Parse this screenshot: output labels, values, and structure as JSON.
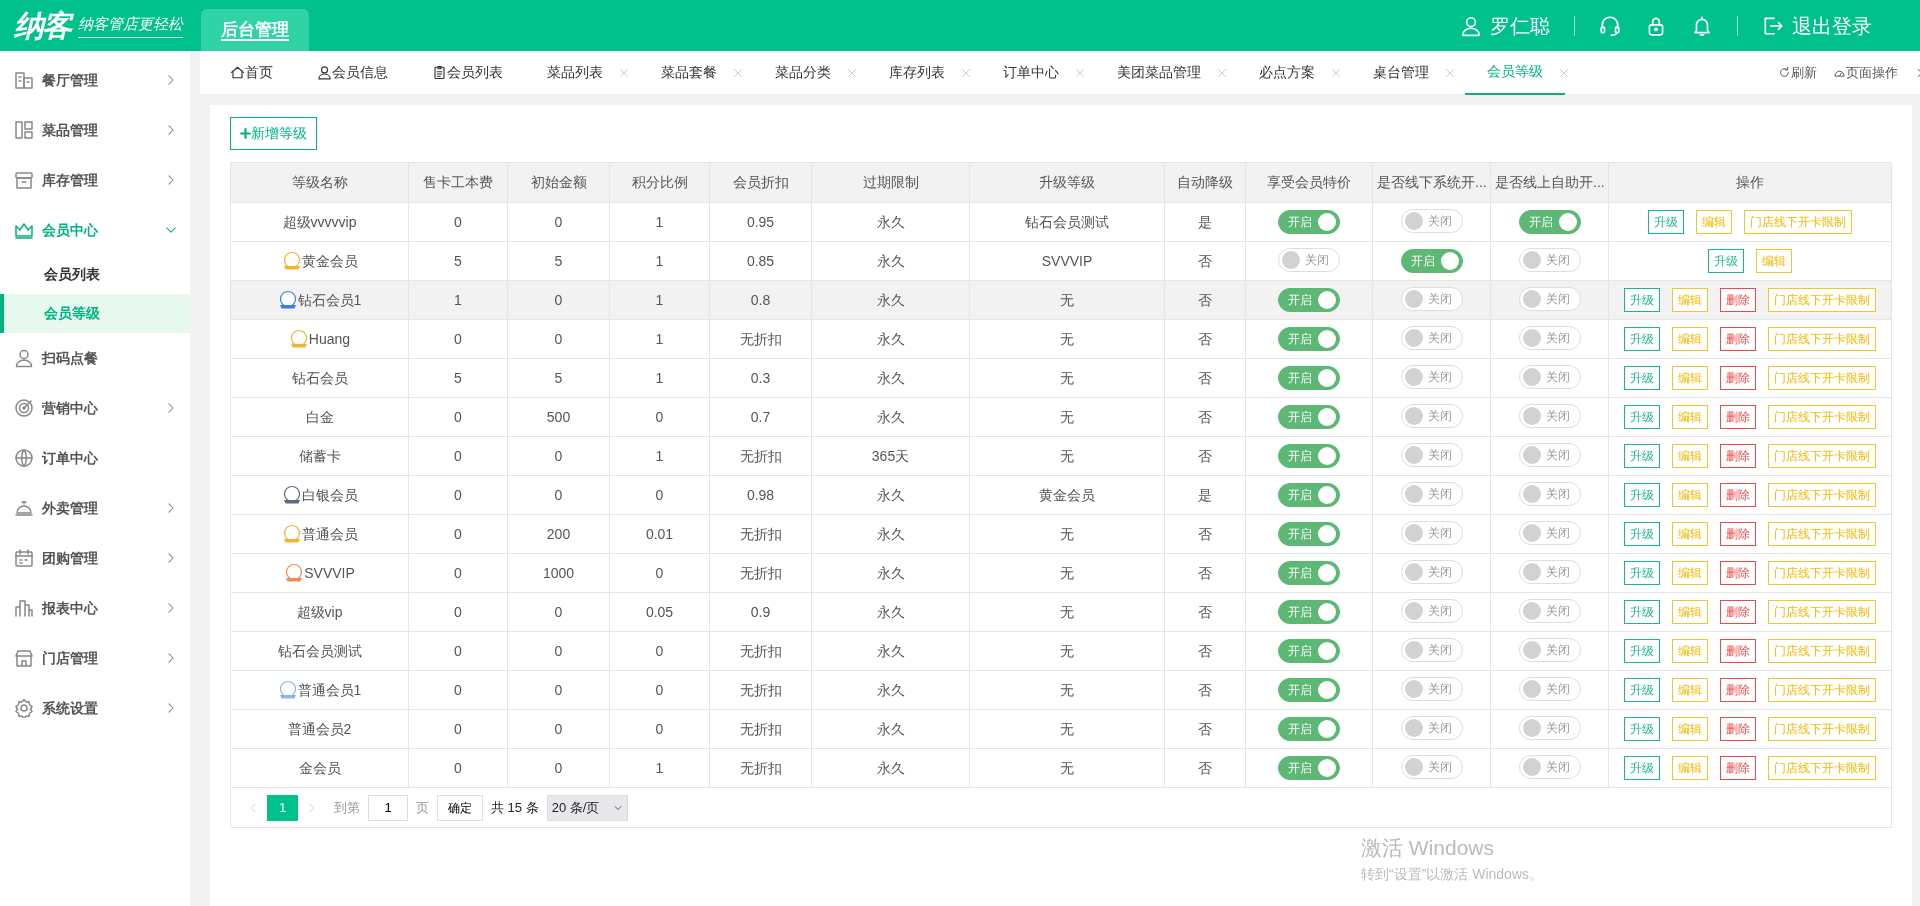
{
  "header": {
    "logo": "纳客",
    "slogan": "纳客管店更轻松",
    "nav": [
      {
        "label": "后台管理",
        "selected": true
      }
    ],
    "user": "罗仁聪",
    "logout": "退出登录"
  },
  "sidebar": {
    "items": [
      {
        "label": "餐厅管理",
        "expandable": true,
        "expanded": false
      },
      {
        "label": "菜品管理",
        "expandable": true,
        "expanded": false
      },
      {
        "label": "库存管理",
        "expandable": true,
        "expanded": false
      },
      {
        "label": "会员中心",
        "expandable": true,
        "expanded": true,
        "children": [
          {
            "label": "会员列表",
            "selected": false
          },
          {
            "label": "会员等级",
            "selected": true
          }
        ]
      },
      {
        "label": "扫码点餐",
        "expandable": false,
        "expanded": false
      },
      {
        "label": "营销中心",
        "expandable": true,
        "expanded": false
      },
      {
        "label": "订单中心",
        "expandable": false,
        "expanded": false
      },
      {
        "label": "外卖管理",
        "expandable": true,
        "expanded": false
      },
      {
        "label": "团购管理",
        "expandable": true,
        "expanded": false
      },
      {
        "label": "报表中心",
        "expandable": true,
        "expanded": false
      },
      {
        "label": "门店管理",
        "expandable": true,
        "expanded": false
      },
      {
        "label": "系统设置",
        "expandable": true,
        "expanded": false
      }
    ]
  },
  "tabs": [
    {
      "label": "首页",
      "closable": false,
      "selected": false
    },
    {
      "label": "会员信息",
      "closable": false,
      "selected": false
    },
    {
      "label": "会员列表",
      "closable": false,
      "selected": false
    },
    {
      "label": "菜品列表",
      "closable": true,
      "selected": false
    },
    {
      "label": "菜品套餐",
      "closable": true,
      "selected": false
    },
    {
      "label": "菜品分类",
      "closable": true,
      "selected": false
    },
    {
      "label": "库存列表",
      "closable": true,
      "selected": false
    },
    {
      "label": "订单中心",
      "closable": true,
      "selected": false
    },
    {
      "label": "美团菜品管理",
      "closable": true,
      "selected": false
    },
    {
      "label": "必点方案",
      "closable": true,
      "selected": false
    },
    {
      "label": "桌台管理",
      "closable": true,
      "selected": false
    },
    {
      "label": "会员等级",
      "closable": true,
      "selected": true
    }
  ],
  "tab_tools": [
    "刷新",
    "页面操作"
  ],
  "add_button": "新增等级",
  "table": {
    "columns": [
      "等级名称",
      "售卡工本费",
      "初始金额",
      "积分比例",
      "会员折扣",
      "过期限制",
      "升级等级",
      "自动降级",
      "享受会员特价",
      "是否线下系统开...",
      "是否线上自助开...",
      "操作"
    ],
    "rows": [
      {
        "hovered": false,
        "cells": [
          "超级vvvvvip",
          "0",
          "0",
          "1",
          "0.95",
          "永久",
          "钻石会员测试",
          "是"
        ],
        "toggles": [
          {
            "label": "开启",
            "on": true
          },
          {
            "label": "关闭",
            "on": false
          },
          {
            "label": "开启",
            "on": true
          }
        ],
        "actions": [
          {
            "kind": "upgrade",
            "label": "升级"
          },
          {
            "kind": "edit",
            "label": "编辑"
          },
          {
            "kind": "limit",
            "label": "门店线下开卡限制"
          }
        ]
      },
      {
        "color": "#f5b335",
        "hovered": false,
        "cells": [
          "黄金会员",
          "5",
          "5",
          "1",
          "0.85",
          "永久",
          "SVVVIP",
          "否"
        ],
        "toggles": [
          {
            "label": "关闭",
            "on": false
          },
          {
            "label": "开启",
            "on": true
          },
          {
            "label": "关闭",
            "on": false
          }
        ],
        "actions": [
          {
            "kind": "upgrade",
            "label": "升级"
          },
          {
            "kind": "edit",
            "label": "编辑"
          }
        ]
      },
      {
        "color": "#3d7fe0",
        "hovered": true,
        "cells": [
          "钻石会员1",
          "1",
          "0",
          "1",
          "0.8",
          "永久",
          "无",
          "否"
        ],
        "toggles": [
          {
            "label": "开启",
            "on": true
          },
          {
            "label": "关闭",
            "on": false
          },
          {
            "label": "关闭",
            "on": false
          }
        ],
        "actions": [
          {
            "kind": "upgrade",
            "label": "升级"
          },
          {
            "kind": "edit",
            "label": "编辑"
          },
          {
            "kind": "delete",
            "label": "删除"
          },
          {
            "kind": "limit",
            "label": "门店线下开卡限制"
          }
        ]
      },
      {
        "color": "#f5b335",
        "hovered": false,
        "cells": [
          "Huang",
          "0",
          "0",
          "1",
          "无折扣",
          "永久",
          "无",
          "否"
        ],
        "toggles": [
          {
            "label": "开启",
            "on": true
          },
          {
            "label": "关闭",
            "on": false
          },
          {
            "label": "关闭",
            "on": false
          }
        ],
        "actions": [
          {
            "kind": "upgrade",
            "label": "升级"
          },
          {
            "kind": "edit",
            "label": "编辑"
          },
          {
            "kind": "delete",
            "label": "删除"
          },
          {
            "kind": "limit",
            "label": "门店线下开卡限制"
          }
        ]
      },
      {
        "hovered": false,
        "cells": [
          "钻石会员",
          "5",
          "5",
          "1",
          "0.3",
          "永久",
          "无",
          "否"
        ],
        "toggles": [
          {
            "label": "开启",
            "on": true
          },
          {
            "label": "关闭",
            "on": false
          },
          {
            "label": "关闭",
            "on": false
          }
        ],
        "actions": [
          {
            "kind": "upgrade",
            "label": "升级"
          },
          {
            "kind": "edit",
            "label": "编辑"
          },
          {
            "kind": "delete",
            "label": "删除"
          },
          {
            "kind": "limit",
            "label": "门店线下开卡限制"
          }
        ]
      },
      {
        "hovered": false,
        "cells": [
          "白金",
          "0",
          "500",
          "0",
          "0.7",
          "永久",
          "无",
          "否"
        ],
        "toggles": [
          {
            "label": "开启",
            "on": true
          },
          {
            "label": "关闭",
            "on": false
          },
          {
            "label": "关闭",
            "on": false
          }
        ],
        "actions": [
          {
            "kind": "upgrade",
            "label": "升级"
          },
          {
            "kind": "edit",
            "label": "编辑"
          },
          {
            "kind": "delete",
            "label": "删除"
          },
          {
            "kind": "limit",
            "label": "门店线下开卡限制"
          }
        ]
      },
      {
        "hovered": false,
        "cells": [
          "储蓄卡",
          "0",
          "0",
          "1",
          "无折扣",
          "365天",
          "无",
          "否"
        ],
        "toggles": [
          {
            "label": "开启",
            "on": true
          },
          {
            "label": "关闭",
            "on": false
          },
          {
            "label": "关闭",
            "on": false
          }
        ],
        "actions": [
          {
            "kind": "upgrade",
            "label": "升级"
          },
          {
            "kind": "edit",
            "label": "编辑"
          },
          {
            "kind": "delete",
            "label": "删除"
          },
          {
            "kind": "limit",
            "label": "门店线下开卡限制"
          }
        ]
      },
      {
        "color": "#5a6a85",
        "hovered": false,
        "cells": [
          "白银会员",
          "0",
          "0",
          "0",
          "0.98",
          "永久",
          "黄金会员",
          "是"
        ],
        "toggles": [
          {
            "label": "开启",
            "on": true
          },
          {
            "label": "关闭",
            "on": false
          },
          {
            "label": "关闭",
            "on": false
          }
        ],
        "actions": [
          {
            "kind": "upgrade",
            "label": "升级"
          },
          {
            "kind": "edit",
            "label": "编辑"
          },
          {
            "kind": "delete",
            "label": "删除"
          },
          {
            "kind": "limit",
            "label": "门店线下开卡限制"
          }
        ]
      },
      {
        "color": "#f5b335",
        "hovered": false,
        "cells": [
          "普通会员",
          "0",
          "200",
          "0.01",
          "无折扣",
          "永久",
          "无",
          "否"
        ],
        "toggles": [
          {
            "label": "开启",
            "on": true
          },
          {
            "label": "关闭",
            "on": false
          },
          {
            "label": "关闭",
            "on": false
          }
        ],
        "actions": [
          {
            "kind": "upgrade",
            "label": "升级"
          },
          {
            "kind": "edit",
            "label": "编辑"
          },
          {
            "kind": "delete",
            "label": "删除"
          },
          {
            "kind": "limit",
            "label": "门店线下开卡限制"
          }
        ]
      },
      {
        "color": "#f08a5a",
        "hovered": false,
        "cells": [
          "SVVVIP",
          "0",
          "1000",
          "0",
          "无折扣",
          "永久",
          "无",
          "否"
        ],
        "toggles": [
          {
            "label": "开启",
            "on": true
          },
          {
            "label": "关闭",
            "on": false
          },
          {
            "label": "关闭",
            "on": false
          }
        ],
        "actions": [
          {
            "kind": "upgrade",
            "label": "升级"
          },
          {
            "kind": "edit",
            "label": "编辑"
          },
          {
            "kind": "delete",
            "label": "删除"
          },
          {
            "kind": "limit",
            "label": "门店线下开卡限制"
          }
        ]
      },
      {
        "hovered": false,
        "cells": [
          "超级vip",
          "0",
          "0",
          "0.05",
          "0.9",
          "永久",
          "无",
          "否"
        ],
        "toggles": [
          {
            "label": "开启",
            "on": true
          },
          {
            "label": "关闭",
            "on": false
          },
          {
            "label": "关闭",
            "on": false
          }
        ],
        "actions": [
          {
            "kind": "upgrade",
            "label": "升级"
          },
          {
            "kind": "edit",
            "label": "编辑"
          },
          {
            "kind": "delete",
            "label": "删除"
          },
          {
            "kind": "limit",
            "label": "门店线下开卡限制"
          }
        ]
      },
      {
        "hovered": false,
        "cells": [
          "钻石会员测试",
          "0",
          "0",
          "0",
          "无折扣",
          "永久",
          "无",
          "否"
        ],
        "toggles": [
          {
            "label": "开启",
            "on": true
          },
          {
            "label": "关闭",
            "on": false
          },
          {
            "label": "关闭",
            "on": false
          }
        ],
        "actions": [
          {
            "kind": "upgrade",
            "label": "升级"
          },
          {
            "kind": "edit",
            "label": "编辑"
          },
          {
            "kind": "delete",
            "label": "删除"
          },
          {
            "kind": "limit",
            "label": "门店线下开卡限制"
          }
        ]
      },
      {
        "color": "#8fb4e8",
        "hovered": false,
        "cells": [
          "普通会员1",
          "0",
          "0",
          "0",
          "无折扣",
          "永久",
          "无",
          "否"
        ],
        "toggles": [
          {
            "label": "开启",
            "on": true
          },
          {
            "label": "关闭",
            "on": false
          },
          {
            "label": "关闭",
            "on": false
          }
        ],
        "actions": [
          {
            "kind": "upgrade",
            "label": "升级"
          },
          {
            "kind": "edit",
            "label": "编辑"
          },
          {
            "kind": "delete",
            "label": "删除"
          },
          {
            "kind": "limit",
            "label": "门店线下开卡限制"
          }
        ]
      },
      {
        "hovered": false,
        "cells": [
          "普通会员2",
          "0",
          "0",
          "0",
          "无折扣",
          "永久",
          "无",
          "否"
        ],
        "toggles": [
          {
            "label": "开启",
            "on": true
          },
          {
            "label": "关闭",
            "on": false
          },
          {
            "label": "关闭",
            "on": false
          }
        ],
        "actions": [
          {
            "kind": "upgrade",
            "label": "升级"
          },
          {
            "kind": "edit",
            "label": "编辑"
          },
          {
            "kind": "delete",
            "label": "删除"
          },
          {
            "kind": "limit",
            "label": "门店线下开卡限制"
          }
        ]
      },
      {
        "hovered": false,
        "cells": [
          "金会员",
          "0",
          "0",
          "1",
          "无折扣",
          "永久",
          "无",
          "否"
        ],
        "toggles": [
          {
            "label": "开启",
            "on": true
          },
          {
            "label": "关闭",
            "on": false
          },
          {
            "label": "关闭",
            "on": false
          }
        ],
        "actions": [
          {
            "kind": "upgrade",
            "label": "升级"
          },
          {
            "kind": "edit",
            "label": "编辑"
          },
          {
            "kind": "delete",
            "label": "删除"
          },
          {
            "kind": "limit",
            "label": "门店线下开卡限制"
          }
        ]
      }
    ]
  },
  "pagination": {
    "pages": [
      {
        "label": "1",
        "selected": true
      }
    ],
    "goto_label": "到第",
    "goto_value": "1",
    "page_unit": "页",
    "confirm": "确定",
    "total": "共 15 条",
    "page_size": "20 条/页"
  },
  "os_notice": {
    "title": "激活 Windows",
    "text": "转到“设置”以激活 Windows。"
  }
}
